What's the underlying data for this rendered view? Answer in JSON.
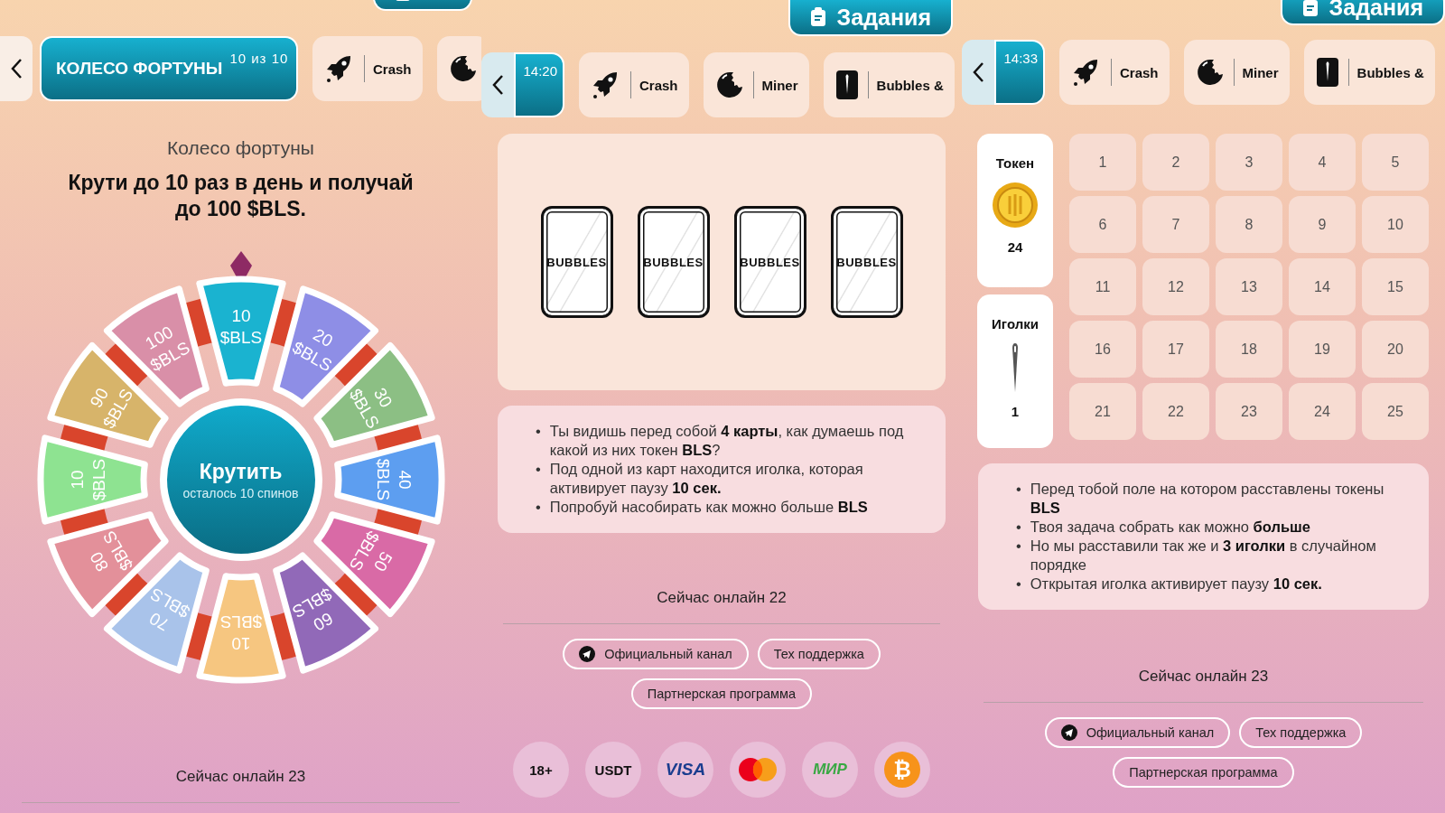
{
  "panels": [
    {
      "kind": "wheel",
      "nav": [
        {
          "kind": "wheel",
          "title": "КОЛЕСО ФОРТУНЫ",
          "counter": "10 из 10",
          "selected": true
        },
        {
          "kind": "rocket",
          "label": "Crash",
          "selected": false
        },
        {
          "kind": "bomb",
          "selected": false
        }
      ],
      "subtitle": "Колесо фортуны",
      "heading": "Крути до 10 раз в день и получай до 100 $BLS.",
      "wheel": {
        "spin_label": "Крутить",
        "spins_left": "осталось 10 спинов",
        "segments": [
          {
            "amount": "10",
            "currency": "$BLS",
            "color": "#1ab3d0"
          },
          {
            "amount": "20",
            "currency": "$BLS",
            "color": "#8e8ee6"
          },
          {
            "amount": "30",
            "currency": "$BLS",
            "color": "#8cbf84"
          },
          {
            "amount": "40",
            "currency": "$BLS",
            "color": "#5d9ef0"
          },
          {
            "amount": "50",
            "currency": "$BLS",
            "color": "#d96aa6"
          },
          {
            "amount": "60",
            "currency": "$BLS",
            "color": "#9169b8"
          },
          {
            "amount": "10",
            "currency": "$BLS",
            "color": "#f6c680"
          },
          {
            "amount": "70",
            "currency": "$BLS",
            "color": "#a9c3ea"
          },
          {
            "amount": "80",
            "currency": "$BLS",
            "color": "#e3909a"
          },
          {
            "amount": "10",
            "currency": "$BLS",
            "color": "#8ee391"
          },
          {
            "amount": "90",
            "currency": "$BLS",
            "color": "#d7b46a"
          },
          {
            "amount": "100",
            "currency": "$BLS",
            "color": "#d98fa8"
          }
        ]
      },
      "online": "Сейчас онлайн 23"
    },
    {
      "kind": "bubbles",
      "tasks_label": "Задания",
      "nav": [
        {
          "kind": "timer",
          "label": "14:20",
          "selected": true
        },
        {
          "kind": "rocket",
          "label": "Crash",
          "selected": false
        },
        {
          "kind": "bomb",
          "label": "Miner",
          "selected": false
        },
        {
          "kind": "needle",
          "label": "Bubbles &",
          "selected": false
        }
      ],
      "cards": [
        {
          "label": "BUBBLES"
        },
        {
          "label": "BUBBLES"
        },
        {
          "label": "BUBBLES"
        },
        {
          "label": "BUBBLES"
        }
      ],
      "rules": [
        {
          "marker": "•",
          "text": "Ты видишь перед собой **4 карты**, как думаешь под какой из них токен **BLS**?"
        },
        {
          "marker": "•",
          "text": "Под одной из карт находится иголка, которая активирует паузу **10 сек.**"
        },
        {
          "marker": "•",
          "text": "Попробуй насобирать как можно больше **BLS**"
        }
      ],
      "online": "Сейчас онлайн 22",
      "links": [
        {
          "kind": "telegram",
          "label": "Официальный канал"
        },
        {
          "kind": "plain",
          "label": "Тех поддержка"
        },
        {
          "kind": "plain",
          "label": "Партнерская программа"
        }
      ],
      "payments": [
        {
          "kind": "text",
          "label": "18+"
        },
        {
          "kind": "text",
          "label": "USDT"
        },
        {
          "kind": "visa",
          "label": "VISA"
        },
        {
          "kind": "mastercard"
        },
        {
          "kind": "mir",
          "label": "МИР"
        },
        {
          "kind": "bitcoin",
          "label": "₿"
        }
      ]
    },
    {
      "kind": "grid",
      "tasks_label": "Задания",
      "nav": [
        {
          "kind": "timer",
          "label": "14:33",
          "selected": true
        },
        {
          "kind": "rocket",
          "label": "Crash",
          "selected": false
        },
        {
          "kind": "bomb",
          "label": "Miner",
          "selected": false
        },
        {
          "kind": "needle",
          "label": "Bubbles &",
          "selected": false
        }
      ],
      "counters": [
        {
          "kind": "coin",
          "label": "Токен",
          "count": "24"
        },
        {
          "kind": "needle",
          "label": "Иголки",
          "count": "1"
        }
      ],
      "cells": [
        "1",
        "2",
        "3",
        "4",
        "5",
        "6",
        "7",
        "8",
        "9",
        "10",
        "11",
        "12",
        "13",
        "14",
        "15",
        "16",
        "17",
        "18",
        "19",
        "20",
        "21",
        "22",
        "23",
        "24",
        "25"
      ],
      "rules": [
        {
          "marker": "•",
          "text": "Перед тобой поле на котором расставлены токены **BLS**"
        },
        {
          "marker": "•",
          "text": "Твоя задача собрать как можно **больше**"
        },
        {
          "marker": "•",
          "text": "Но мы расставили так же и **3 иголки** в случайном порядке"
        },
        {
          "marker": "•",
          "text": "Открытая иголка активирует паузу **10 сек.**"
        }
      ],
      "online": "Сейчас онлайн 23",
      "links": [
        {
          "kind": "telegram",
          "label": "Официальный канал"
        },
        {
          "kind": "plain",
          "label": "Тех поддержка"
        },
        {
          "kind": "plain",
          "label": "Партнерская программа"
        }
      ]
    }
  ]
}
